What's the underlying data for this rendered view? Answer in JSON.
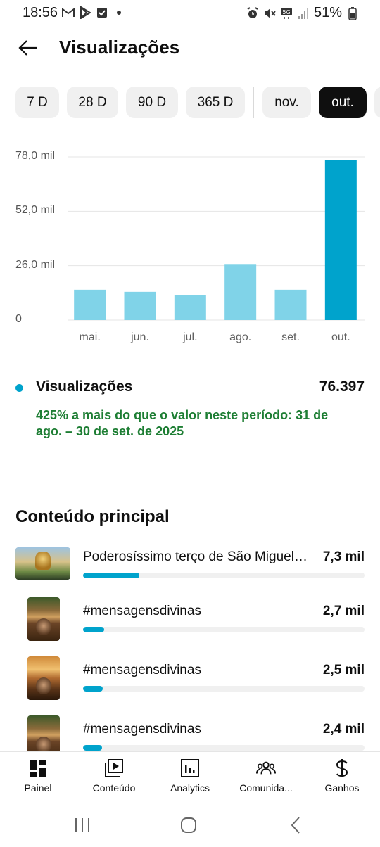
{
  "status_bar": {
    "time": "18:56",
    "battery": "51%",
    "left_icons": [
      "gmail-icon",
      "play-store-icon",
      "task-check-icon",
      "dot-icon"
    ],
    "right_icons": [
      "alarm-icon",
      "mute-icon",
      "5g-icon",
      "signal-icon",
      "battery-icon"
    ]
  },
  "header": {
    "title": "Visualizações"
  },
  "periods": [
    {
      "label": "7 D",
      "active": false
    },
    {
      "label": "28 D",
      "active": false
    },
    {
      "label": "90 D",
      "active": false
    },
    {
      "label": "365 D",
      "active": false
    },
    {
      "label": "nov.",
      "active": false
    },
    {
      "label": "out.",
      "active": true
    }
  ],
  "chart_data": {
    "type": "bar",
    "categories": [
      "mai.",
      "jun.",
      "jul.",
      "ago.",
      "set.",
      "out."
    ],
    "values": [
      14500,
      13500,
      12000,
      26800,
      14500,
      76397
    ],
    "highlighted_index": 5,
    "y_ticks": [
      "0",
      "26,0 mil",
      "52,0 mil",
      "78,0 mil"
    ],
    "ylim": [
      0,
      78000
    ],
    "grid": true,
    "colors": {
      "bar": "#80d3e8",
      "highlight": "#00a3cc",
      "grid": "#e5e5e5"
    }
  },
  "metric": {
    "name": "Visualizações",
    "value": "76.397",
    "comparison": "425% a mais do que o valor neste período: 31 de ago. – 30 de set. de 2025",
    "color": "#00a3cc",
    "comparison_color": "#1e7e34"
  },
  "top_content": {
    "title": "Conteúdo principal",
    "items": [
      {
        "title": "Poderosíssimo terço de São Miguel Arcanjo",
        "views": "7,3 mil",
        "ratio": 0.2,
        "thumb": "wide"
      },
      {
        "title": "#mensagensdivinas",
        "views": "2,7 mil",
        "ratio": 0.075,
        "thumb": "tall"
      },
      {
        "title": "#mensagensdivinas",
        "views": "2,5 mil",
        "ratio": 0.07,
        "thumb": "tall-b"
      },
      {
        "title": "#mensagensdivinas",
        "views": "2,4 mil",
        "ratio": 0.068,
        "thumb": "tall"
      }
    ]
  },
  "bottom_nav": {
    "items": [
      {
        "label": "Painel",
        "icon": "dashboard-icon"
      },
      {
        "label": "Conteúdo",
        "icon": "content-icon"
      },
      {
        "label": "Analytics",
        "icon": "analytics-icon"
      },
      {
        "label": "Comunida...",
        "icon": "community-icon"
      },
      {
        "label": "Ganhos",
        "icon": "earnings-icon"
      }
    ]
  },
  "system_nav": [
    "recents-icon",
    "home-icon",
    "back-nav-icon"
  ]
}
